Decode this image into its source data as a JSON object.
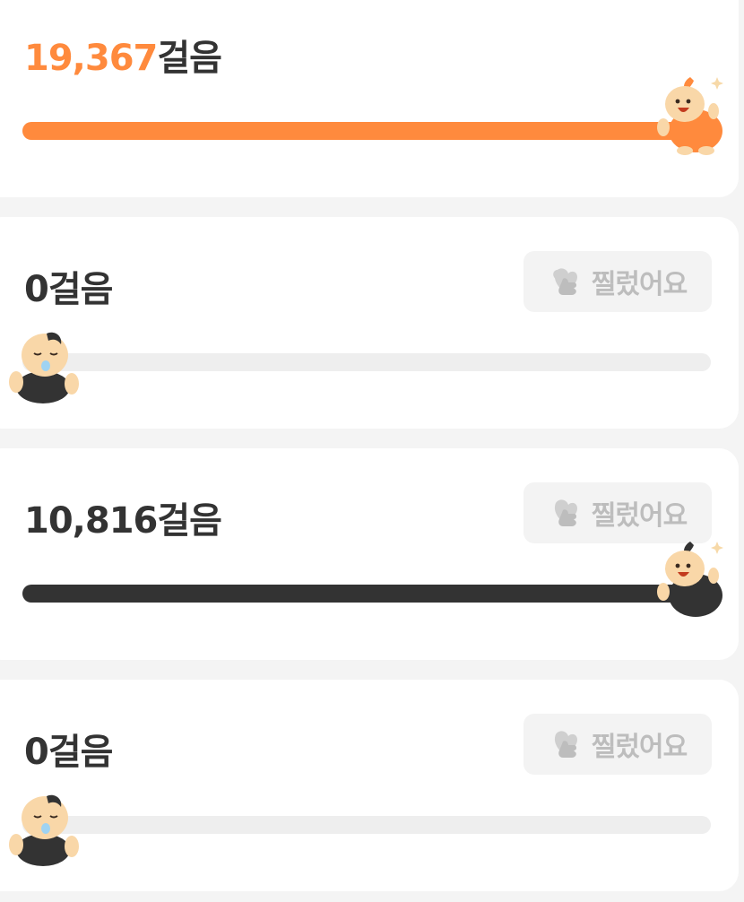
{
  "steps_suffix": "걸음",
  "colors": {
    "accent": "#ff8a3d",
    "dark": "#333333",
    "track": "#eeeeee",
    "button_bg": "#f3f3f3",
    "button_text": "#bdbdbd"
  },
  "entries": [
    {
      "steps": "19,367",
      "progress_percent": 100,
      "is_me": true,
      "poke_label": ""
    },
    {
      "steps": "0",
      "progress_percent": 0,
      "is_me": false,
      "poke_label": "찔렀어요"
    },
    {
      "steps": "10,816",
      "progress_percent": 100,
      "is_me": false,
      "poke_label": "찔렀어요"
    },
    {
      "steps": "0",
      "progress_percent": 0,
      "is_me": false,
      "poke_label": "찔렀어요"
    }
  ],
  "icons": {
    "poke": "poke-hand-icon",
    "mascot_active_me": "cheering-mascot-orange-icon",
    "mascot_active_friend": "cheering-mascot-dark-icon",
    "mascot_sleeping": "sleeping-baby-mascot-icon"
  }
}
